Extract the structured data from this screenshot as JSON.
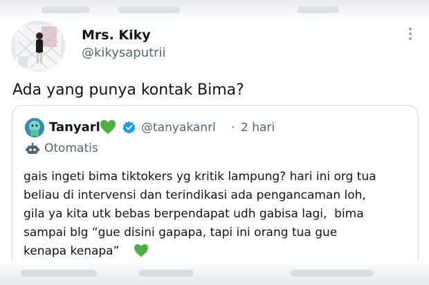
{
  "tweet": {
    "author_name": "Mrs. Kiky",
    "author_handle": "@kikysaputrii",
    "text": "Ada yang punya kontak Bima?"
  },
  "quoted": {
    "author_name": "Tanyarl",
    "author_handle": "@tanyakanrl",
    "separator": "·",
    "time": "2 hari",
    "automated_label": "Otomatis",
    "text_lines": [
      "gais ingeti bima tiktokers yg kritik lampung? hari ini org tua",
      "beliau di intervensi dan terindikasi ada pengancaman loh,",
      "gila ya kita utk bebas berpendapat udh gabisa lagi,  bima",
      "sampai blg “gue disini gapapa, tapi ini orang tua gue",
      "kenapa kenapa”"
    ]
  },
  "icons": {
    "more": "more-vertical-icon",
    "verified": "verified-badge-icon",
    "heart": "green-heart-icon",
    "bot": "robot-icon"
  },
  "colors": {
    "text": "#0f1419",
    "secondary": "#536471",
    "border": "#cfd9de",
    "verified": "#1d9bf0",
    "heart": "#4caf3f"
  }
}
